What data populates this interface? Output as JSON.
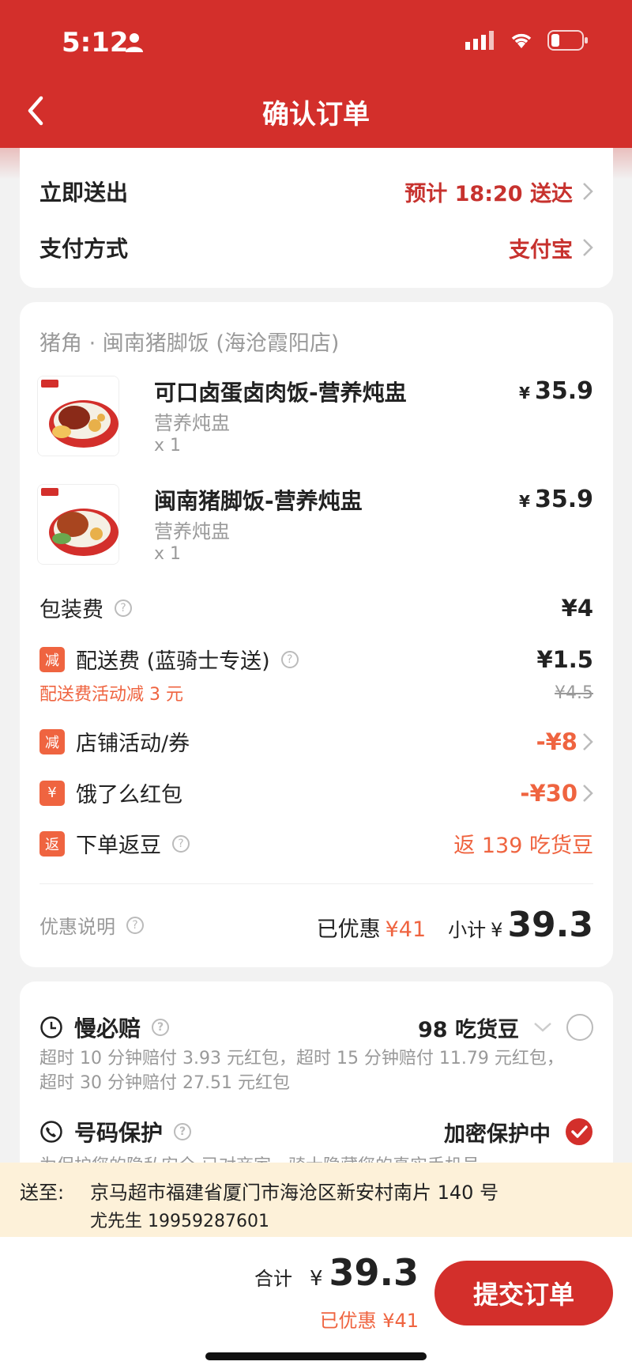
{
  "status_bar": {
    "time": "5:12"
  },
  "header": {
    "title": "确认订单"
  },
  "delivery": {
    "mode_label": "立即送出",
    "eta": "预计 18:20 送达",
    "payment_label": "支付方式",
    "payment_value": "支付宝"
  },
  "order": {
    "store": "猪角 · 闽南猪脚饭 (海沧霞阳店)",
    "items": [
      {
        "name": "可口卤蛋卤肉饭-营养炖盅",
        "spec": "营养炖盅",
        "qty": "x 1",
        "price": "35.9",
        "currency": "¥"
      },
      {
        "name": "闽南猪脚饭-营养炖盅",
        "spec": "营养炖盅",
        "qty": "x 1",
        "price": "35.9",
        "currency": "¥"
      }
    ],
    "packaging": {
      "label": "包装费",
      "amount": "¥4"
    },
    "delivery_fee": {
      "badge": "减",
      "label": "配送费 (蓝骑士专送)",
      "amount": "¥1.5",
      "note": "配送费活动减 3 元",
      "original": "¥4.5"
    },
    "store_promo": {
      "badge": "减",
      "label": "店铺活动/券",
      "amount": "-¥8"
    },
    "red_packet": {
      "badge": "¥",
      "label": "饿了么红包",
      "amount": "-¥30"
    },
    "beans": {
      "badge": "返",
      "label": "下单返豆",
      "value": "返 139 吃货豆"
    },
    "discount_note": "优惠说明",
    "saved_label": "已优惠",
    "saved_value": "¥41",
    "subtotal_label": "小计",
    "subtotal_currency": "¥",
    "subtotal_value": "39.3"
  },
  "services": {
    "slow_compensation": {
      "title": "慢必赔",
      "cost": "98 吃货豆",
      "line1": "超时 10 分钟赔付 3.93 元红包，超时 15 分钟赔付 11.79 元红包，",
      "line2": "超时 30 分钟赔付 27.51 元红包",
      "selected": false
    },
    "number_protection": {
      "title": "号码保护",
      "status": "加密保护中",
      "desc": "为保护您的隐私安全,已对商家、骑士隐藏您的真实手机号",
      "selected": true
    }
  },
  "address": {
    "label": "送至:",
    "line": "京马超市福建省厦门市海沧区新安村南片 140 号",
    "contact": "尤先生 19959287601"
  },
  "footer": {
    "total_label": "合计",
    "total_currency": "¥",
    "total_value": "39.3",
    "saved": "已优惠 ¥41",
    "submit_label": "提交订单"
  },
  "colors": {
    "brand_red": "#d32f2b",
    "accent_orange": "#ef6440",
    "banner_bg": "#fdf1d9"
  }
}
